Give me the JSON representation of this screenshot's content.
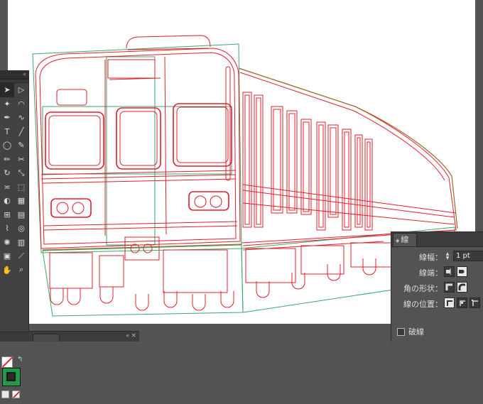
{
  "artwork": {
    "subject": "train front outline drawing",
    "colors": {
      "path_red": "#e0202c",
      "guide_green": "#3aa66a",
      "edge_brown": "#9c6a2a"
    }
  },
  "tools_panel": {
    "collapse_glyph": "«",
    "close_glyph": "×",
    "tools": [
      "selection-icon",
      "direct-selection-icon",
      "magic-wand-icon",
      "lasso-icon",
      "pen-icon",
      "curvature-icon",
      "type-icon",
      "line-segment-icon",
      "ellipse-icon",
      "paintbrush-icon",
      "pencil-icon",
      "scissors-icon",
      "rotate-icon",
      "scale-icon",
      "width-icon",
      "free-transform-icon",
      "shape-builder-icon",
      "perspective-grid-icon",
      "mesh-icon",
      "gradient-icon",
      "eyedropper-icon",
      "blend-icon",
      "symbol-sprayer-icon",
      "column-graph-icon",
      "artboard-icon",
      "slice-icon",
      "hand-icon",
      "zoom-icon"
    ],
    "fill_color": "none",
    "stroke_color": "#1e9a4a"
  },
  "stroke_panel": {
    "tab_label": "線",
    "weight_label": "線幅：",
    "weight_value": "1 pt",
    "cap_label": "線端：",
    "corner_label": "角の形状：",
    "align_label": "線の位置：",
    "dashed_label": "破線",
    "dashed_checked": false
  },
  "bottom_panel": {
    "collapse_glyph": "«",
    "close_glyph": "×"
  }
}
